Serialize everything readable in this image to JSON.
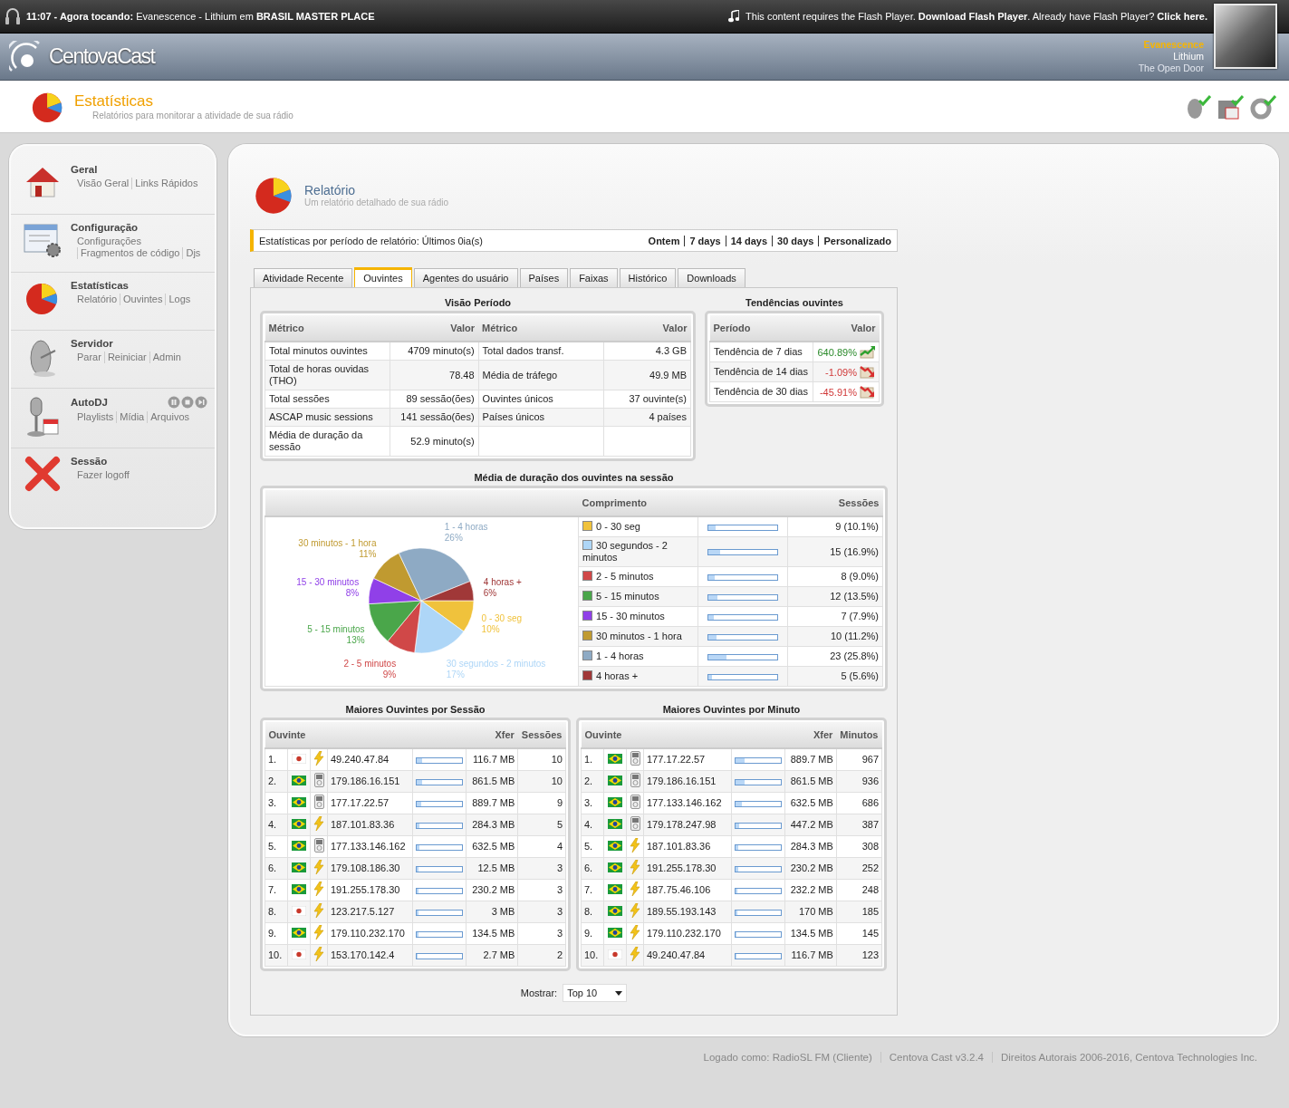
{
  "now_playing_bar": {
    "text": "**11:07 - Agora tocando:** Evanescence - Lithium em **BRASIL MASTER PLACE**",
    "flash_notice": {
      "before": "This content requires the Flash Player.",
      "download_link": "Download Flash Player",
      "middle": ". Already have Flash Player?",
      "click_link": "Click here."
    }
  },
  "header": {
    "logo": "CentovaCast",
    "track": {
      "artist": "Evanescence",
      "title": "Lithium",
      "album": "The Open Door"
    }
  },
  "page_title": {
    "title": "Estatísticas",
    "subtitle": "Relatórios para monitorar a atividade de sua rádio"
  },
  "sidebar": {
    "sections": [
      {
        "kind": "home",
        "title": "Geral",
        "links": [
          "Visão Geral",
          "Links Rápidos"
        ]
      },
      {
        "kind": "config",
        "title": "Configuração",
        "links": [
          "Configurações",
          "Fragmentos de código",
          "Djs"
        ]
      },
      {
        "kind": "stats",
        "title": "Estatísticas",
        "links": [
          "Relatório",
          "Ouvintes",
          "Logs"
        ]
      },
      {
        "kind": "server",
        "title": "Servidor",
        "links": [
          "Parar",
          "Reiniciar",
          "Admin"
        ]
      },
      {
        "kind": "autodj",
        "title": "AutoDJ",
        "links": [
          "Playlists",
          "Mídia",
          "Arquivos"
        ]
      },
      {
        "kind": "session",
        "title": "Sessão",
        "links": [
          "Fazer logoff"
        ]
      }
    ]
  },
  "report": {
    "title": "Relatório",
    "subtitle": "Um relatório detalhado de sua rádio",
    "period": {
      "label": "Estatísticas por período de relatório: Últimos 0ia(s)",
      "options": [
        "Ontem",
        "7 days",
        "14 days",
        "30 days",
        "Personalizado"
      ]
    },
    "tabs": [
      {
        "label": "Atividade Recente",
        "selected": false
      },
      {
        "label": "Ouvintes",
        "selected": true
      },
      {
        "label": "Agentes do usuário",
        "selected": false
      },
      {
        "label": "Países",
        "selected": false
      },
      {
        "label": "Faixas",
        "selected": false
      },
      {
        "label": "Histórico",
        "selected": false
      },
      {
        "label": "Downloads",
        "selected": false
      }
    ],
    "overview": {
      "title": "Visão Período",
      "columns": [
        "Métrico",
        "Valor",
        "Métrico",
        "Valor"
      ],
      "rows": [
        [
          "Total minutos ouvintes",
          "4709 minuto(s)",
          "Total dados transf.",
          "4.3 GB"
        ],
        [
          "Total de horas ouvidas (THO)",
          "78.48",
          "Média de tráfego",
          "49.9 MB"
        ],
        [
          "Total sessões",
          "89 sessão(ões)",
          "Ouvintes únicos",
          "37 ouvinte(s)"
        ],
        [
          "ASCAP music sessions",
          "141 sessão(ões)",
          "Países únicos",
          "4 países"
        ],
        [
          "Média de duração da sessão",
          "52.9 minuto(s)"
        ]
      ]
    },
    "trends": {
      "title": "Tendências ouvintes",
      "columns": [
        "Período",
        "Valor"
      ],
      "rows": [
        {
          "period": "Tendência de 7 dias",
          "value": "640.89%",
          "kind": "up"
        },
        {
          "period": "Tendência de 14 dias",
          "value": "-1.09%",
          "kind": "down"
        },
        {
          "period": "Tendência de 30 dias",
          "value": "-45.91%",
          "kind": "down"
        }
      ]
    },
    "duration": {
      "title": "Média de duração dos ouvintes na sessão",
      "columns": [
        "Comprimento"
      ],
      "chart_data": {
        "type": "pie",
        "categories": [
          "0 - 30 seg",
          "30 segundos - 2 minutos",
          "2 - 5 minutos",
          "5 - 15 minutos",
          "15 - 30 minutos",
          "30 minutos - 1 hora",
          "1 - 4 horas",
          "4 horas +"
        ],
        "series": [
          {
            "name": "Sessões",
            "values": [
              10,
              17,
              9,
              13,
              8,
              11,
              26,
              6
            ]
          }
        ],
        "value_labels": [
          "10%",
          "17%",
          "9%",
          "13%",
          "8%",
          "11%",
          "26%",
          "6%"
        ]
      },
      "rows": [
        {
          "label": "0 - 30 seg",
          "color": "#f0c23c",
          "level": 0.101,
          "sessions": "9 (10.1%)"
        },
        {
          "label": "30 segundos - 2 minutos",
          "color": "#aed6f7",
          "level": 0.169,
          "sessions": "15 (16.9%)"
        },
        {
          "label": "2 - 5 minutos",
          "color": "#d04848",
          "level": 0.09,
          "sessions": "8 (9.0%)"
        },
        {
          "label": "5 - 15 minutos",
          "color": "#4aa64a",
          "level": 0.135,
          "sessions": "12 (13.5%)"
        },
        {
          "label": "15 - 30 minutos",
          "color": "#9040e8",
          "level": 0.079,
          "sessions": "7 (7.9%)"
        },
        {
          "label": "30 minutos - 1 hora",
          "color": "#c09a30",
          "level": 0.112,
          "sessions": "10 (11.2%)"
        },
        {
          "label": "1 - 4 horas",
          "color": "#8eaac4",
          "level": 0.258,
          "sessions": "23 (25.8%)"
        },
        {
          "label": "4 horas +",
          "color": "#a03838",
          "level": 0.056,
          "sessions": "5 (5.6%)"
        }
      ]
    },
    "top_listeners": [
      {
        "title": "Maiores Ouvintes por Sessão",
        "columns": [
          "Ouvinte",
          "Xfer",
          "Sessões"
        ],
        "rows": [
          {
            "rank": "1.",
            "flag": {
              "kind": "japan"
            },
            "client": {
              "kind": "flash"
            },
            "ip": "49.240.47.84",
            "level": 0.112,
            "xfer": "116.7 MB",
            "count": "10"
          },
          {
            "rank": "2.",
            "flag": {
              "kind": "brazil"
            },
            "client": {
              "kind": "player"
            },
            "ip": "179.186.16.151",
            "level": 0.112,
            "xfer": "861.5 MB",
            "count": "10"
          },
          {
            "rank": "3.",
            "flag": {
              "kind": "brazil"
            },
            "client": {
              "kind": "player"
            },
            "ip": "177.17.22.57",
            "level": 0.101,
            "xfer": "889.7 MB",
            "count": "9"
          },
          {
            "rank": "4.",
            "flag": {
              "kind": "brazil"
            },
            "client": {
              "kind": "flash"
            },
            "ip": "187.101.83.36",
            "level": 0.056,
            "xfer": "284.3 MB",
            "count": "5"
          },
          {
            "rank": "5.",
            "flag": {
              "kind": "brazil"
            },
            "client": {
              "kind": "player"
            },
            "ip": "177.133.146.162",
            "level": 0.045,
            "xfer": "632.5 MB",
            "count": "4"
          },
          {
            "rank": "6.",
            "flag": {
              "kind": "brazil"
            },
            "client": {
              "kind": "flash"
            },
            "ip": "179.108.186.30",
            "level": 0.034,
            "xfer": "12.5 MB",
            "count": "3"
          },
          {
            "rank": "7.",
            "flag": {
              "kind": "brazil"
            },
            "client": {
              "kind": "flash"
            },
            "ip": "191.255.178.30",
            "level": 0.034,
            "xfer": "230.2 MB",
            "count": "3"
          },
          {
            "rank": "8.",
            "flag": {
              "kind": "japan"
            },
            "client": {
              "kind": "flash"
            },
            "ip": "123.217.5.127",
            "level": 0.034,
            "xfer": "3 MB",
            "count": "3"
          },
          {
            "rank": "9.",
            "flag": {
              "kind": "brazil"
            },
            "client": {
              "kind": "flash"
            },
            "ip": "179.110.232.170",
            "level": 0.034,
            "xfer": "134.5 MB",
            "count": "3"
          },
          {
            "rank": "10.",
            "flag": {
              "kind": "japan"
            },
            "client": {
              "kind": "flash"
            },
            "ip": "153.170.142.4",
            "level": 0.022,
            "xfer": "2.7 MB",
            "count": "2"
          }
        ]
      },
      {
        "title": "Maiores Ouvintes por Minuto",
        "columns": [
          "Ouvinte",
          "Xfer",
          "Minutos"
        ],
        "rows": [
          {
            "rank": "1.",
            "flag": {
              "kind": "brazil"
            },
            "client": {
              "kind": "player"
            },
            "ip": "177.17.22.57",
            "level": 0.205,
            "xfer": "889.7 MB",
            "count": "967"
          },
          {
            "rank": "2.",
            "flag": {
              "kind": "brazil"
            },
            "client": {
              "kind": "player"
            },
            "ip": "179.186.16.151",
            "level": 0.199,
            "xfer": "861.5 MB",
            "count": "936"
          },
          {
            "rank": "3.",
            "flag": {
              "kind": "brazil"
            },
            "client": {
              "kind": "player"
            },
            "ip": "177.133.146.162",
            "level": 0.146,
            "xfer": "632.5 MB",
            "count": "686"
          },
          {
            "rank": "4.",
            "flag": {
              "kind": "brazil"
            },
            "client": {
              "kind": "player"
            },
            "ip": "179.178.247.98",
            "level": 0.082,
            "xfer": "447.2 MB",
            "count": "387"
          },
          {
            "rank": "5.",
            "flag": {
              "kind": "brazil"
            },
            "client": {
              "kind": "flash"
            },
            "ip": "187.101.83.36",
            "level": 0.065,
            "xfer": "284.3 MB",
            "count": "308"
          },
          {
            "rank": "6.",
            "flag": {
              "kind": "brazil"
            },
            "client": {
              "kind": "flash"
            },
            "ip": "191.255.178.30",
            "level": 0.054,
            "xfer": "230.2 MB",
            "count": "252"
          },
          {
            "rank": "7.",
            "flag": {
              "kind": "brazil"
            },
            "client": {
              "kind": "flash"
            },
            "ip": "187.75.46.106",
            "level": 0.053,
            "xfer": "232.2 MB",
            "count": "248"
          },
          {
            "rank": "8.",
            "flag": {
              "kind": "brazil"
            },
            "client": {
              "kind": "flash"
            },
            "ip": "189.55.193.143",
            "level": 0.039,
            "xfer": "170 MB",
            "count": "185"
          },
          {
            "rank": "9.",
            "flag": {
              "kind": "brazil"
            },
            "client": {
              "kind": "flash"
            },
            "ip": "179.110.232.170",
            "level": 0.031,
            "xfer": "134.5 MB",
            "count": "145"
          },
          {
            "rank": "10.",
            "flag": {
              "kind": "japan"
            },
            "client": {
              "kind": "flash"
            },
            "ip": "49.240.47.84",
            "level": 0.026,
            "xfer": "116.7 MB",
            "count": "123"
          }
        ]
      }
    ],
    "show": {
      "label": "Mostrar:",
      "value": "Top 10"
    }
  },
  "footer": [
    "Logado como: RadioSL FM (Cliente)",
    "Centova Cast v3.2.4",
    "Direitos Autorais 2006-2016, Centova Technologies Inc."
  ]
}
